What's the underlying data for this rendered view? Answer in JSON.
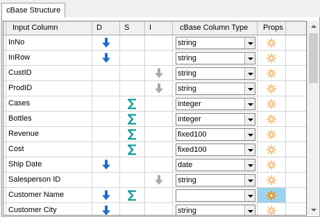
{
  "tab": {
    "label": "cBase Structure"
  },
  "columns": {
    "input_column": "Input Column",
    "d": "D",
    "s": "S",
    "i": "I",
    "cbase_type": "cBase Column Type",
    "props": "Props"
  },
  "rows": [
    {
      "name": "InNo",
      "type": "string",
      "d": true,
      "s": false,
      "i": false
    },
    {
      "name": "InRow",
      "type": "string",
      "d": true,
      "s": false,
      "i": false
    },
    {
      "name": "CustID",
      "type": "string",
      "d": false,
      "s": false,
      "i": true
    },
    {
      "name": "ProdID",
      "type": "string",
      "d": false,
      "s": false,
      "i": true
    },
    {
      "name": "Cases",
      "type": "integer",
      "d": false,
      "s": true,
      "i": false
    },
    {
      "name": "Bottles",
      "type": "integer",
      "d": false,
      "s": true,
      "i": false
    },
    {
      "name": "Revenue",
      "type": "fixed100",
      "d": false,
      "s": true,
      "i": false
    },
    {
      "name": "Cost",
      "type": "fixed100",
      "d": false,
      "s": true,
      "i": false
    },
    {
      "name": "Ship Date",
      "type": "date",
      "d": true,
      "s": false,
      "i": false
    },
    {
      "name": "Salesperson ID",
      "type": "string",
      "d": false,
      "s": false,
      "i": true
    },
    {
      "name": "Customer Name",
      "type": "",
      "d": true,
      "s": true,
      "i": false,
      "selected": true
    },
    {
      "name": "Customer City",
      "type": "string",
      "d": true,
      "s": false,
      "i": false
    }
  ],
  "icons": {
    "dimension": "arrow-down-blue-icon",
    "summary": "sigma-teal-icon",
    "index": "arrow-down-gray-icon",
    "props": "gear-props-icon"
  },
  "colors": {
    "dimension_arrow": "#1f6fc5",
    "sigma": "#169a9a",
    "index_arrow": "#a8a8a8",
    "props_gear": "#f3c98f",
    "selected_props": "#9ed3ee"
  }
}
